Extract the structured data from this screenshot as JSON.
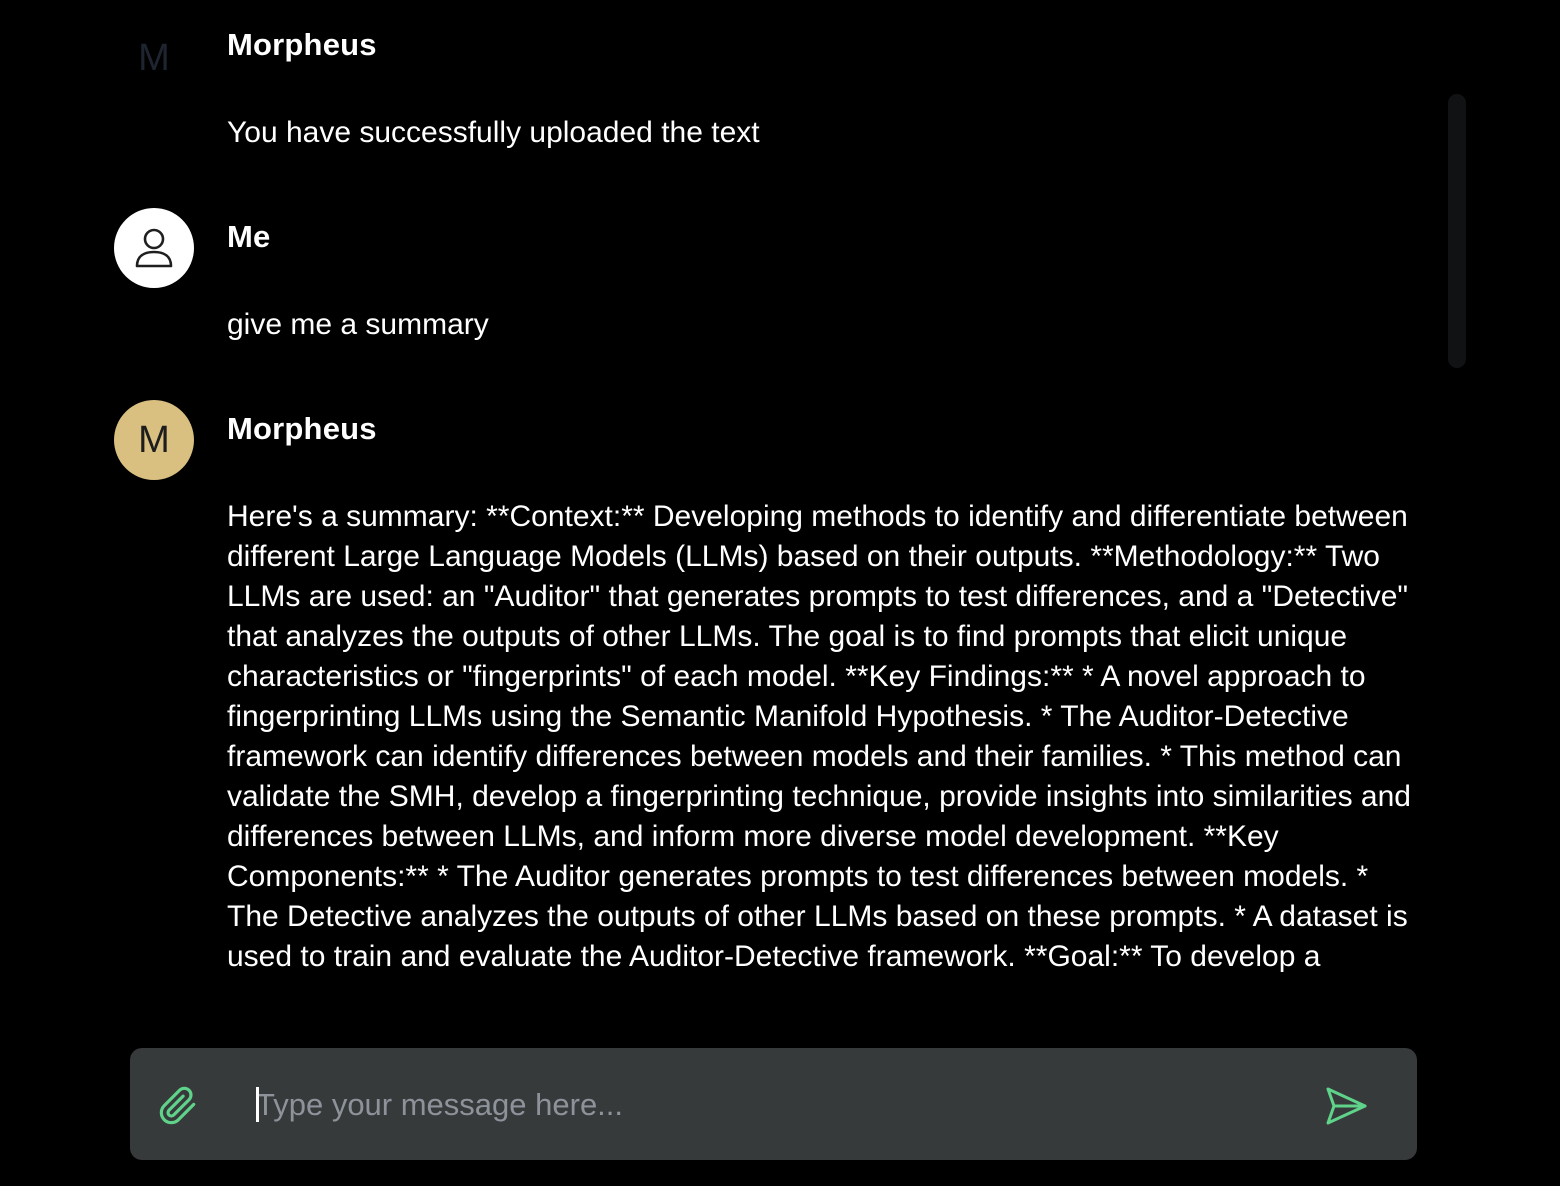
{
  "messages": [
    {
      "sender": "Morpheus",
      "avatar_letter": "M",
      "text": "You have successfully uploaded the text"
    },
    {
      "sender": "Me",
      "avatar_icon": "user-icon",
      "text": "give me a summary"
    },
    {
      "sender": "Morpheus",
      "avatar_letter": "M",
      "text": "Here's a summary: **Context:** Developing methods to identify and differentiate between different Large Language Models (LLMs) based on their outputs. **Methodology:** Two LLMs are used: an \"Auditor\" that generates prompts to test differences, and a \"Detective\" that analyzes the outputs of other LLMs. The goal is to find prompts that elicit unique characteristics or \"fingerprints\" of each model. **Key Findings:** * A novel approach to fingerprinting LLMs using the Semantic Manifold Hypothesis. * The Auditor-Detective framework can identify differences between models and their families. * This method can validate the SMH, develop a fingerprinting technique, provide insights into similarities and differences between LLMs, and inform more diverse model development. **Key Components:** * The Auditor generates prompts to test differences between models. * The Detective analyzes the outputs of other LLMs based on these prompts. * A dataset is used to train and evaluate the Auditor-Detective framework. **Goal:** To develop a"
    }
  ],
  "composer": {
    "placeholder": "Type your message here...",
    "value": "",
    "attach_icon": "paperclip-icon",
    "send_icon": "send-icon"
  },
  "colors": {
    "background": "#000000",
    "composer_bg": "#373a3a",
    "bot_avatar": "#d9bf80",
    "accent_green": "#5fd38a",
    "placeholder": "#8e939b"
  }
}
